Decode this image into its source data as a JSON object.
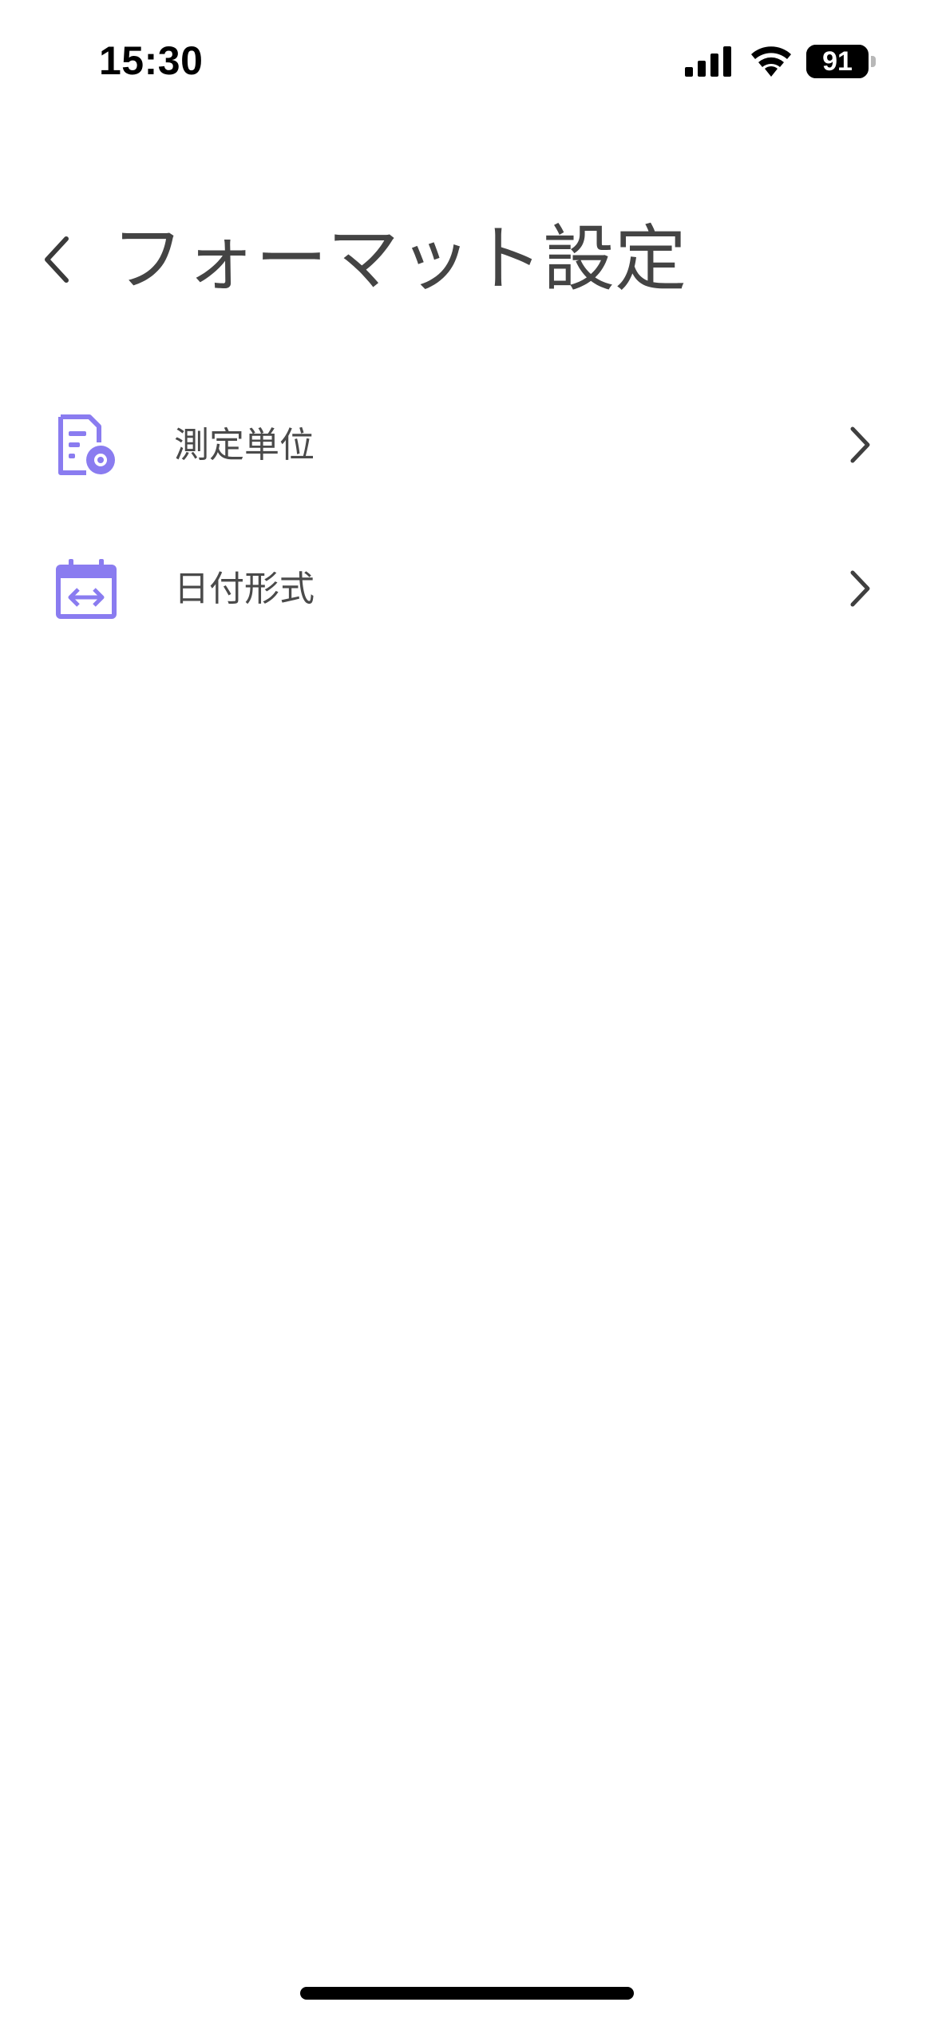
{
  "status_bar": {
    "time": "15:30",
    "battery_text": "91",
    "battery_percent": 91,
    "icons": [
      "signal-icon",
      "wifi-icon",
      "battery-icon"
    ]
  },
  "header": {
    "back_icon": "chevron-left-icon",
    "title": "フォーマット設定"
  },
  "settings": {
    "items": [
      {
        "label": "測定単位",
        "icon": "measurement-unit-icon",
        "trailing_icon": "chevron-right-icon"
      },
      {
        "label": "日付形式",
        "icon": "calendar-arrows-icon",
        "trailing_icon": "chevron-right-icon"
      }
    ]
  },
  "colors": {
    "accent": "#8A7CF0",
    "text_primary": "#444444",
    "text_secondary": "#4A4A4A",
    "background": "#FFFFFF"
  }
}
